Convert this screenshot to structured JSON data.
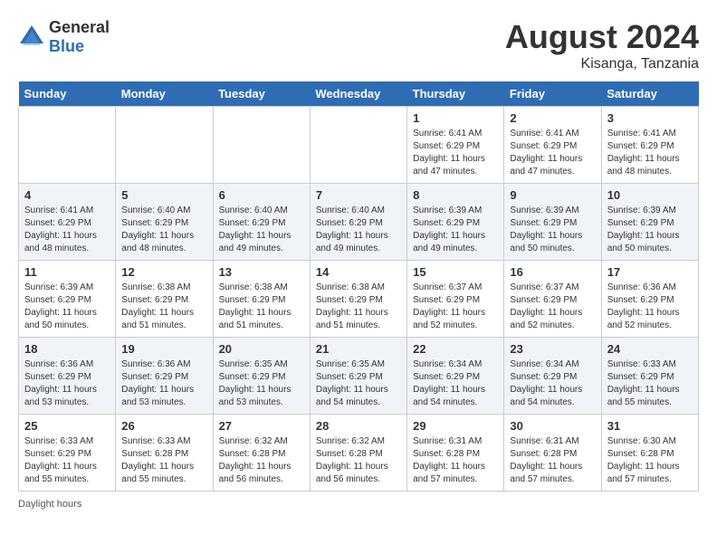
{
  "header": {
    "logo_general": "General",
    "logo_blue": "Blue",
    "month_year": "August 2024",
    "location": "Kisanga, Tanzania"
  },
  "days_of_week": [
    "Sunday",
    "Monday",
    "Tuesday",
    "Wednesday",
    "Thursday",
    "Friday",
    "Saturday"
  ],
  "weeks": [
    [
      {
        "day": "",
        "info": ""
      },
      {
        "day": "",
        "info": ""
      },
      {
        "day": "",
        "info": ""
      },
      {
        "day": "",
        "info": ""
      },
      {
        "day": "1",
        "info": "Sunrise: 6:41 AM\nSunset: 6:29 PM\nDaylight: 11 hours\nand 47 minutes."
      },
      {
        "day": "2",
        "info": "Sunrise: 6:41 AM\nSunset: 6:29 PM\nDaylight: 11 hours\nand 47 minutes."
      },
      {
        "day": "3",
        "info": "Sunrise: 6:41 AM\nSunset: 6:29 PM\nDaylight: 11 hours\nand 48 minutes."
      }
    ],
    [
      {
        "day": "4",
        "info": "Sunrise: 6:41 AM\nSunset: 6:29 PM\nDaylight: 11 hours\nand 48 minutes."
      },
      {
        "day": "5",
        "info": "Sunrise: 6:40 AM\nSunset: 6:29 PM\nDaylight: 11 hours\nand 48 minutes."
      },
      {
        "day": "6",
        "info": "Sunrise: 6:40 AM\nSunset: 6:29 PM\nDaylight: 11 hours\nand 49 minutes."
      },
      {
        "day": "7",
        "info": "Sunrise: 6:40 AM\nSunset: 6:29 PM\nDaylight: 11 hours\nand 49 minutes."
      },
      {
        "day": "8",
        "info": "Sunrise: 6:39 AM\nSunset: 6:29 PM\nDaylight: 11 hours\nand 49 minutes."
      },
      {
        "day": "9",
        "info": "Sunrise: 6:39 AM\nSunset: 6:29 PM\nDaylight: 11 hours\nand 50 minutes."
      },
      {
        "day": "10",
        "info": "Sunrise: 6:39 AM\nSunset: 6:29 PM\nDaylight: 11 hours\nand 50 minutes."
      }
    ],
    [
      {
        "day": "11",
        "info": "Sunrise: 6:39 AM\nSunset: 6:29 PM\nDaylight: 11 hours\nand 50 minutes."
      },
      {
        "day": "12",
        "info": "Sunrise: 6:38 AM\nSunset: 6:29 PM\nDaylight: 11 hours\nand 51 minutes."
      },
      {
        "day": "13",
        "info": "Sunrise: 6:38 AM\nSunset: 6:29 PM\nDaylight: 11 hours\nand 51 minutes."
      },
      {
        "day": "14",
        "info": "Sunrise: 6:38 AM\nSunset: 6:29 PM\nDaylight: 11 hours\nand 51 minutes."
      },
      {
        "day": "15",
        "info": "Sunrise: 6:37 AM\nSunset: 6:29 PM\nDaylight: 11 hours\nand 52 minutes."
      },
      {
        "day": "16",
        "info": "Sunrise: 6:37 AM\nSunset: 6:29 PM\nDaylight: 11 hours\nand 52 minutes."
      },
      {
        "day": "17",
        "info": "Sunrise: 6:36 AM\nSunset: 6:29 PM\nDaylight: 11 hours\nand 52 minutes."
      }
    ],
    [
      {
        "day": "18",
        "info": "Sunrise: 6:36 AM\nSunset: 6:29 PM\nDaylight: 11 hours\nand 53 minutes."
      },
      {
        "day": "19",
        "info": "Sunrise: 6:36 AM\nSunset: 6:29 PM\nDaylight: 11 hours\nand 53 minutes."
      },
      {
        "day": "20",
        "info": "Sunrise: 6:35 AM\nSunset: 6:29 PM\nDaylight: 11 hours\nand 53 minutes."
      },
      {
        "day": "21",
        "info": "Sunrise: 6:35 AM\nSunset: 6:29 PM\nDaylight: 11 hours\nand 54 minutes."
      },
      {
        "day": "22",
        "info": "Sunrise: 6:34 AM\nSunset: 6:29 PM\nDaylight: 11 hours\nand 54 minutes."
      },
      {
        "day": "23",
        "info": "Sunrise: 6:34 AM\nSunset: 6:29 PM\nDaylight: 11 hours\nand 54 minutes."
      },
      {
        "day": "24",
        "info": "Sunrise: 6:33 AM\nSunset: 6:29 PM\nDaylight: 11 hours\nand 55 minutes."
      }
    ],
    [
      {
        "day": "25",
        "info": "Sunrise: 6:33 AM\nSunset: 6:29 PM\nDaylight: 11 hours\nand 55 minutes."
      },
      {
        "day": "26",
        "info": "Sunrise: 6:33 AM\nSunset: 6:28 PM\nDaylight: 11 hours\nand 55 minutes."
      },
      {
        "day": "27",
        "info": "Sunrise: 6:32 AM\nSunset: 6:28 PM\nDaylight: 11 hours\nand 56 minutes."
      },
      {
        "day": "28",
        "info": "Sunrise: 6:32 AM\nSunset: 6:28 PM\nDaylight: 11 hours\nand 56 minutes."
      },
      {
        "day": "29",
        "info": "Sunrise: 6:31 AM\nSunset: 6:28 PM\nDaylight: 11 hours\nand 57 minutes."
      },
      {
        "day": "30",
        "info": "Sunrise: 6:31 AM\nSunset: 6:28 PM\nDaylight: 11 hours\nand 57 minutes."
      },
      {
        "day": "31",
        "info": "Sunrise: 6:30 AM\nSunset: 6:28 PM\nDaylight: 11 hours\nand 57 minutes."
      }
    ]
  ],
  "footer": {
    "daylight_label": "Daylight hours"
  }
}
